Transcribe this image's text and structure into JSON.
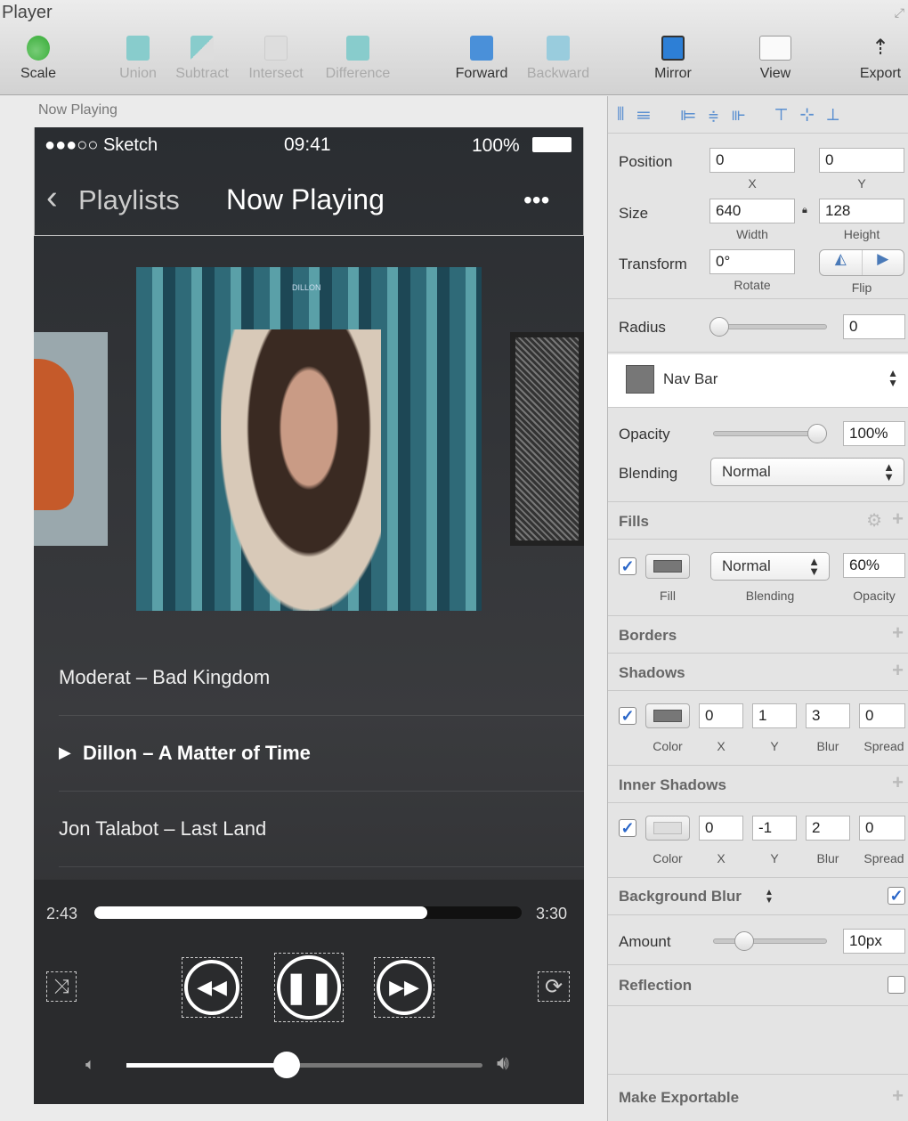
{
  "window": {
    "title": "Player"
  },
  "toolbar": {
    "items": [
      {
        "label": "Scale",
        "icon": "scale-icon",
        "enabled": true
      },
      {
        "label": "Union",
        "icon": "union-icon",
        "enabled": false
      },
      {
        "label": "Subtract",
        "icon": "subtract-icon",
        "enabled": false
      },
      {
        "label": "Intersect",
        "icon": "intersect-icon",
        "enabled": false
      },
      {
        "label": "Difference",
        "icon": "difference-icon",
        "enabled": false
      },
      {
        "label": "Forward",
        "icon": "forward-icon",
        "enabled": true
      },
      {
        "label": "Backward",
        "icon": "backward-icon",
        "enabled": false
      },
      {
        "label": "Mirror",
        "icon": "mirror-icon",
        "enabled": true
      },
      {
        "label": "View",
        "icon": "view-icon",
        "enabled": true
      },
      {
        "label": "Export",
        "icon": "export-icon",
        "enabled": true
      }
    ]
  },
  "artboard": {
    "label": "Now Playing"
  },
  "phone": {
    "status": {
      "carrier": "●●●○○ Sketch",
      "time": "09:41",
      "battery": "100%"
    },
    "nav": {
      "back": "Playlists",
      "title": "Now Playing",
      "more": "•••"
    },
    "album": {
      "art_text": "DILLON"
    },
    "songs": [
      {
        "title": "Moderat – Bad Kingdom",
        "playing": false
      },
      {
        "title": "Dillon – A Matter of Time",
        "playing": true
      },
      {
        "title": "Jon Talabot – Last Land",
        "playing": false
      }
    ],
    "progress": {
      "elapsed": "2:43",
      "total": "3:30",
      "fraction": 0.78
    },
    "volume": {
      "fraction": 0.45
    }
  },
  "inspector": {
    "position": {
      "label": "Position",
      "x": "0",
      "y": "0",
      "x_label": "X",
      "y_label": "Y"
    },
    "size": {
      "label": "Size",
      "width": "640",
      "height": "128",
      "width_label": "Width",
      "height_label": "Height"
    },
    "transform": {
      "label": "Transform",
      "rotate": "0°",
      "rotate_label": "Rotate",
      "flip_label": "Flip"
    },
    "radius": {
      "label": "Radius",
      "value": "0",
      "fraction": 0
    },
    "style": {
      "name": "Nav Bar"
    },
    "opacity": {
      "label": "Opacity",
      "value": "100%",
      "fraction": 1
    },
    "blending": {
      "label": "Blending",
      "value": "Normal"
    },
    "fills": {
      "header": "Fills",
      "enabled": true,
      "fill_label": "Fill",
      "blending": "Normal",
      "blending_label": "Blending",
      "opacity": "60%",
      "opacity_label": "Opacity"
    },
    "borders": {
      "header": "Borders"
    },
    "shadows": {
      "header": "Shadows",
      "enabled": true,
      "x": "0",
      "y": "1",
      "blur": "3",
      "spread": "0",
      "labels": [
        "Color",
        "X",
        "Y",
        "Blur",
        "Spread"
      ]
    },
    "inner_shadows": {
      "header": "Inner Shadows",
      "enabled": true,
      "x": "0",
      "y": "-1",
      "blur": "2",
      "spread": "0",
      "labels": [
        "Color",
        "X",
        "Y",
        "Blur",
        "Spread"
      ]
    },
    "background_blur": {
      "header": "Background Blur",
      "enabled": true,
      "amount_label": "Amount",
      "amount": "10px",
      "fraction": 0.25
    },
    "reflection": {
      "header": "Reflection",
      "enabled": false
    },
    "export": {
      "header": "Make Exportable"
    }
  }
}
